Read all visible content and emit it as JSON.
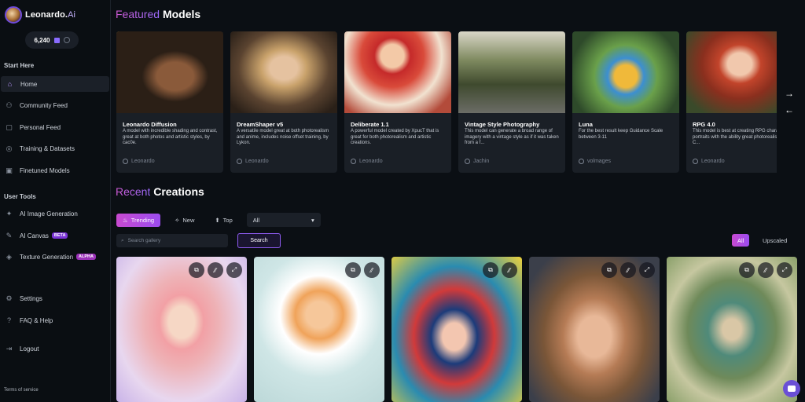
{
  "brand": {
    "name": "Leonardo.",
    "name_suffix": "Ai"
  },
  "tokens": {
    "count": "6,240"
  },
  "sidebar": {
    "start_here_title": "Start Here",
    "start_items": [
      {
        "label": "Home",
        "icon": "home-icon"
      },
      {
        "label": "Community Feed",
        "icon": "community-icon"
      },
      {
        "label": "Personal Feed",
        "icon": "personal-feed-icon"
      },
      {
        "label": "Training & Datasets",
        "icon": "training-icon"
      },
      {
        "label": "Finetuned Models",
        "icon": "models-icon"
      }
    ],
    "user_tools_title": "User Tools",
    "tool_items": [
      {
        "label": "AI Image Generation",
        "icon": "image-generation-icon"
      },
      {
        "label": "AI Canvas",
        "icon": "canvas-icon",
        "badge": "BETA"
      },
      {
        "label": "Texture Generation",
        "icon": "texture-icon",
        "badge": "ALPHA"
      }
    ],
    "bottom_items": [
      {
        "label": "Settings",
        "icon": "gear-icon"
      },
      {
        "label": "FAQ & Help",
        "icon": "help-icon"
      },
      {
        "label": "Logout",
        "icon": "logout-icon"
      }
    ],
    "terms": "Terms of service"
  },
  "featured": {
    "title_accent": "Featured",
    "title_rest": "Models",
    "models": [
      {
        "name": "Leonardo Diffusion",
        "desc": "A model with incredible shading and contrast, great at both photos and artistic styles, by cac0e.",
        "author": "Leonardo"
      },
      {
        "name": "DreamShaper v5",
        "desc": "A versatile model great at both photorealism and anime, includes noise offset training, by Lykon.",
        "author": "Leonardo"
      },
      {
        "name": "Deliberate 1.1",
        "desc": "A powerful model created by XpucT that is great for both photorealism and artistic creations.",
        "author": "Leonardo"
      },
      {
        "name": "Vintage Style Photography",
        "desc": "This model can generate a broad range of imagery with a vintage style as if it was taken from a f...",
        "author": "Jachin"
      },
      {
        "name": "Luna",
        "desc": "For the best result keep Guidance Scale between 3-11",
        "author": "volmages"
      },
      {
        "name": "RPG 4.0",
        "desc": "This model is best at creating RPG character portraits with the ability great photorealism. C...",
        "author": "Leonardo"
      }
    ]
  },
  "recent": {
    "title_accent": "Recent",
    "title_rest": "Creations",
    "filters": {
      "trending": "Trending",
      "new": "New",
      "top": "Top"
    },
    "select_value": "All",
    "search_placeholder": "Search gallery",
    "search_button": "Search",
    "toggle_all": "All",
    "toggle_upscaled": "Upscaled"
  },
  "colors": {
    "accent": "#a855f7",
    "background": "#0b0f14"
  }
}
